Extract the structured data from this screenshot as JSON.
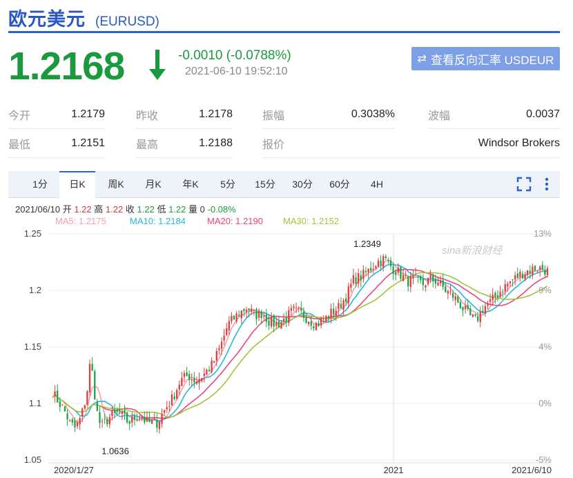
{
  "header": {
    "title": "欧元美元",
    "code": "(EURUSD)"
  },
  "quote": {
    "price": "1.2168",
    "change": "-0.0010 (-0.0788%)",
    "time": "2021-06-10 19:52:10",
    "reverse_button": "查看反向汇率 USDEUR",
    "down_color": "#1a9a3c"
  },
  "stats": [
    [
      {
        "label": "今开",
        "value": "1.2179"
      },
      {
        "label": "昨收",
        "value": "1.2178"
      },
      {
        "label": "振幅",
        "value": "0.3038%"
      },
      {
        "label": "波幅",
        "value": "0.0037"
      }
    ],
    [
      {
        "label": "最低",
        "value": "1.2151"
      },
      {
        "label": "最高",
        "value": "1.2188"
      },
      {
        "label": "报价",
        "value": "Windsor Brokers"
      }
    ]
  ],
  "tabs": [
    "1分",
    "日K",
    "周K",
    "月K",
    "年K",
    "5分",
    "15分",
    "30分",
    "60分",
    "4H"
  ],
  "active_tab": "日K",
  "toolbar": {
    "fullscreen_icon": "fullscreen-icon",
    "more_icon": "more-vertical-icon"
  },
  "info_line": {
    "date": "2021/06/10",
    "open_label": "开",
    "open": "1.22",
    "high_label": "高",
    "high": "1.22",
    "close_label": "收",
    "close": "1.22",
    "low_label": "低",
    "low": "1.22",
    "vol_label": "量",
    "vol": "0",
    "pct": "-0.08%"
  },
  "ma_legend": [
    {
      "text": "MA5: 1.2175",
      "color": "#f29db4"
    },
    {
      "text": "MA10: 1.2184",
      "color": "#25b8d6"
    },
    {
      "text": "MA20: 1.2190",
      "color": "#e8457a"
    },
    {
      "text": "MA30: 1.2152",
      "color": "#a3c43a"
    }
  ],
  "chart_data": {
    "type": "candlestick",
    "watermark": "sina新浪财经",
    "y_ticks_left": [
      "1.25",
      "1.2",
      "1.15",
      "1.1",
      "1.05"
    ],
    "y_ticks_right": [
      "13%",
      "9%",
      "4%",
      "0%",
      "-5%"
    ],
    "x_ticks": [
      "2020/1/27",
      "2021",
      "2021/6/10"
    ],
    "ylim": [
      1.05,
      1.25
    ],
    "annotations": [
      {
        "text": "1.2349",
        "value": 1.2349
      },
      {
        "text": "1.0636",
        "value": 1.0636
      }
    ],
    "grid": true,
    "up_color": "#e23c3c",
    "down_color": "#1ea447",
    "close_path": [
      [
        0,
        1.11
      ],
      [
        6,
        1.102
      ],
      [
        12,
        1.095
      ],
      [
        18,
        1.083
      ],
      [
        24,
        1.078
      ],
      [
        30,
        1.088
      ],
      [
        36,
        1.108
      ],
      [
        40,
        1.14
      ],
      [
        44,
        1.11
      ],
      [
        48,
        1.085
      ],
      [
        52,
        1.08
      ],
      [
        60,
        1.088
      ],
      [
        70,
        1.092
      ],
      [
        80,
        1.083
      ],
      [
        90,
        1.09
      ],
      [
        100,
        1.083
      ],
      [
        110,
        1.083
      ],
      [
        118,
        1.095
      ],
      [
        126,
        1.105
      ],
      [
        134,
        1.12
      ],
      [
        142,
        1.125
      ],
      [
        150,
        1.12
      ],
      [
        158,
        1.125
      ],
      [
        168,
        1.135
      ],
      [
        176,
        1.15
      ],
      [
        184,
        1.17
      ],
      [
        190,
        1.175
      ],
      [
        196,
        1.18
      ],
      [
        204,
        1.185
      ],
      [
        212,
        1.178
      ],
      [
        220,
        1.18
      ],
      [
        228,
        1.172
      ],
      [
        236,
        1.17
      ],
      [
        244,
        1.175
      ],
      [
        252,
        1.182
      ],
      [
        260,
        1.18
      ],
      [
        268,
        1.175
      ],
      [
        276,
        1.17
      ],
      [
        284,
        1.173
      ],
      [
        292,
        1.18
      ],
      [
        300,
        1.185
      ],
      [
        308,
        1.195
      ],
      [
        316,
        1.21
      ],
      [
        324,
        1.212
      ],
      [
        332,
        1.218
      ],
      [
        340,
        1.225
      ],
      [
        348,
        1.228
      ],
      [
        356,
        1.22
      ],
      [
        364,
        1.215
      ],
      [
        372,
        1.208
      ],
      [
        380,
        1.21
      ],
      [
        388,
        1.205
      ],
      [
        396,
        1.21
      ],
      [
        404,
        1.208
      ],
      [
        412,
        1.2
      ],
      [
        420,
        1.195
      ],
      [
        428,
        1.187
      ],
      [
        436,
        1.178
      ],
      [
        444,
        1.173
      ],
      [
        452,
        1.185
      ],
      [
        460,
        1.19
      ],
      [
        468,
        1.198
      ],
      [
        476,
        1.205
      ],
      [
        484,
        1.21
      ],
      [
        492,
        1.215
      ],
      [
        500,
        1.218
      ],
      [
        508,
        1.22
      ],
      [
        514,
        1.219
      ],
      [
        519,
        1.217
      ]
    ]
  }
}
